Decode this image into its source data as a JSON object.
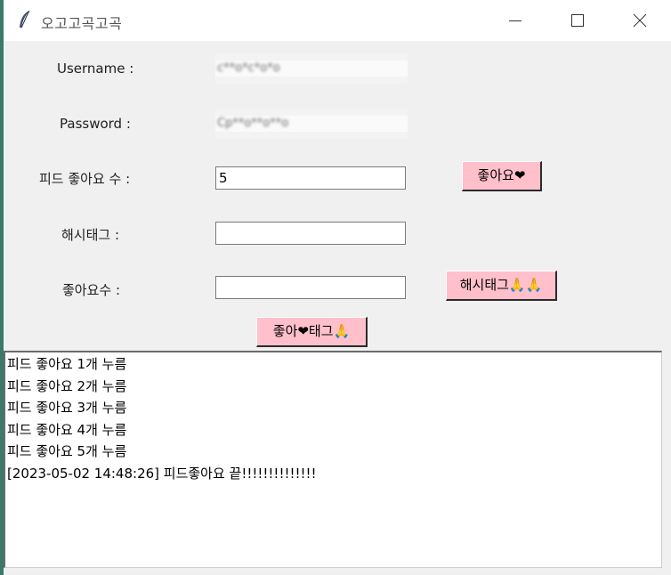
{
  "window": {
    "title": "오고고곡고곡",
    "icon": "feather-icon",
    "controls": [
      "minimize-icon",
      "maximize-icon",
      "close-icon"
    ]
  },
  "form": {
    "username_label": "Username :",
    "username_value": "c**o*c*o*o",
    "password_label": "Password :",
    "password_value": "Cp**o**o**o",
    "feed_like_label": "피드 좋아요 수 :",
    "feed_like_value": "5",
    "hashtag_label": "해시태그 :",
    "hashtag_value": "",
    "like_count_label": "좋아요수 :",
    "like_count_value": ""
  },
  "buttons": {
    "like": "좋아요❤",
    "hashtag": "해시태그🙏🙏",
    "like_tag": "좋아❤태그🙏"
  },
  "log": {
    "lines": [
      "피드 좋아요 1개 누름",
      "피드 좋아요 2개 누름",
      "피드 좋아요 3개 누름",
      "피드 좋아요 4개 누름",
      "피드 좋아요 5개 누름",
      "[2023-05-02 14:48:26] 피드좋아요 끝!!!!!!!!!!!!!!"
    ]
  },
  "colors": {
    "button_bg": "#ffc0cb",
    "window_bg": "#f0f0f0",
    "desktop_bg": "#3a7a68"
  }
}
